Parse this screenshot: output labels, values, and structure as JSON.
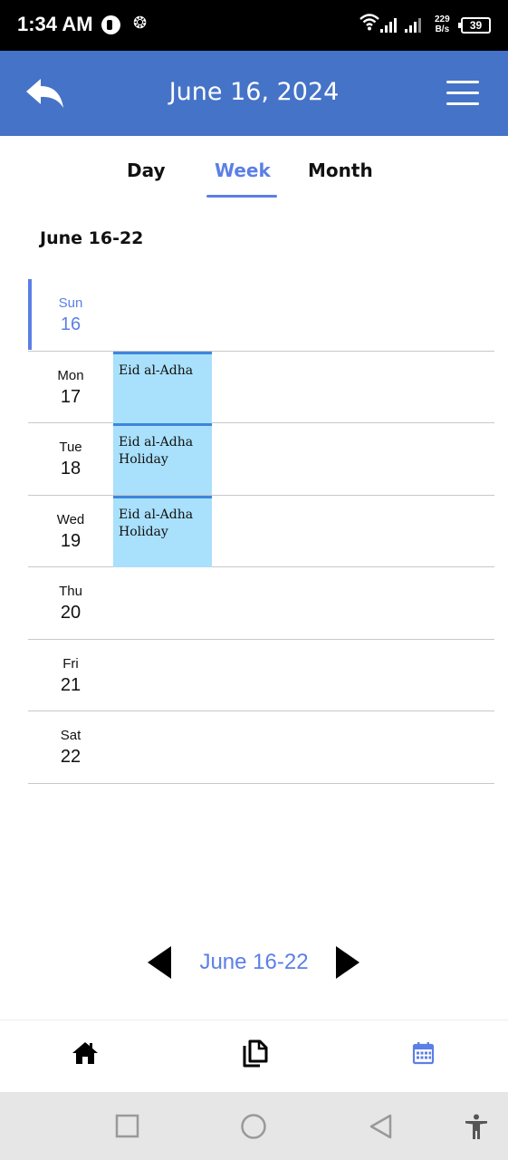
{
  "status_bar": {
    "time": "1:34 AM",
    "net_speed_value": "229",
    "net_speed_unit": "B/s",
    "battery": "39"
  },
  "app_bar": {
    "title": "June 16, 2024",
    "back_icon": "reply-arrow-icon",
    "menu_icon": "hamburger-menu-icon",
    "color": "#4573C7"
  },
  "tabs": [
    {
      "label": "Day",
      "active": false
    },
    {
      "label": "Week",
      "active": true
    },
    {
      "label": "Month",
      "active": false
    }
  ],
  "range_title": "June 16-22",
  "days": [
    {
      "name": "Sun",
      "num": "16",
      "selected": true,
      "event": ""
    },
    {
      "name": "Mon",
      "num": "17",
      "selected": false,
      "event": "Eid al-Adha"
    },
    {
      "name": "Tue",
      "num": "18",
      "selected": false,
      "event": "Eid al-Adha Holiday"
    },
    {
      "name": "Wed",
      "num": "19",
      "selected": false,
      "event": "Eid al-Adha Holiday"
    },
    {
      "name": "Thu",
      "num": "20",
      "selected": false,
      "event": ""
    },
    {
      "name": "Fri",
      "num": "21",
      "selected": false,
      "event": ""
    },
    {
      "name": "Sat",
      "num": "22",
      "selected": false,
      "event": ""
    }
  ],
  "pager": {
    "label": "June 16-22",
    "prev_icon": "triangle-left-icon",
    "next_icon": "triangle-right-icon"
  },
  "bottom_nav": [
    {
      "icon": "home-icon",
      "active": false
    },
    {
      "icon": "documents-icon",
      "active": false
    },
    {
      "icon": "calendar-icon",
      "active": true
    }
  ],
  "colors": {
    "accent": "#5B7FE6",
    "event_fill": "#A9E0FB",
    "event_border": "#3D86DB"
  }
}
